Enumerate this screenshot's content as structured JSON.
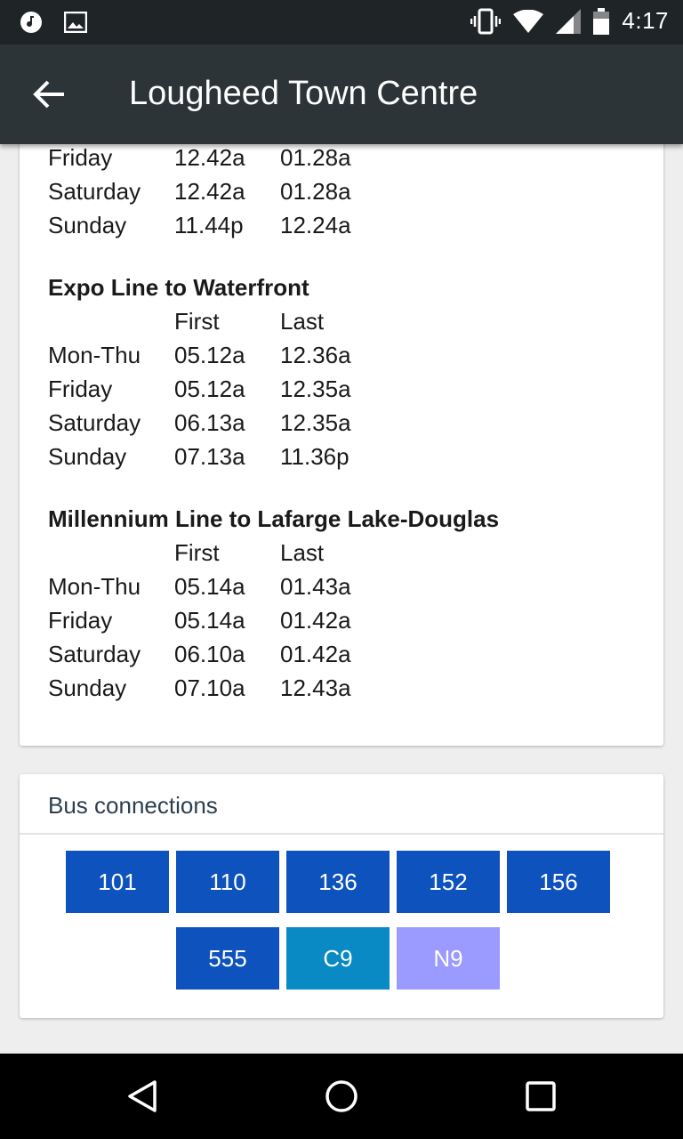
{
  "status_bar": {
    "time": "4:17",
    "icons_left": [
      "music-icon",
      "image-icon"
    ],
    "icons_right": [
      "vibrate-icon",
      "wifi-icon",
      "signal-icon",
      "battery-icon"
    ]
  },
  "app_bar": {
    "title": "Lougheed Town Centre",
    "back_icon": "arrow-back-icon"
  },
  "schedule": {
    "partial_rows": [
      {
        "day": "Friday",
        "first": "12.42a",
        "last": "01.28a"
      },
      {
        "day": "Saturday",
        "first": "12.42a",
        "last": "01.28a"
      },
      {
        "day": "Sunday",
        "first": "11.44p",
        "last": "12.24a"
      }
    ],
    "sections": [
      {
        "title": "Expo Line to Waterfront",
        "first_label": "First",
        "last_label": "Last",
        "rows": [
          {
            "day": "Mon-Thu",
            "first": "05.12a",
            "last": "12.36a"
          },
          {
            "day": "Friday",
            "first": "05.12a",
            "last": "12.35a"
          },
          {
            "day": "Saturday",
            "first": "06.13a",
            "last": "12.35a"
          },
          {
            "day": "Sunday",
            "first": "07.13a",
            "last": "11.36p"
          }
        ]
      },
      {
        "title": "Millennium Line to Lafarge Lake-Douglas",
        "first_label": "First",
        "last_label": "Last",
        "rows": [
          {
            "day": "Mon-Thu",
            "first": "05.14a",
            "last": "01.43a"
          },
          {
            "day": "Friday",
            "first": "05.14a",
            "last": "01.42a"
          },
          {
            "day": "Saturday",
            "first": "06.10a",
            "last": "01.42a"
          },
          {
            "day": "Sunday",
            "first": "07.10a",
            "last": "12.43a"
          }
        ]
      }
    ]
  },
  "bus_connections": {
    "title": "Bus connections",
    "routes": [
      {
        "label": "101",
        "color": "#0d52bd"
      },
      {
        "label": "110",
        "color": "#0d52bd"
      },
      {
        "label": "136",
        "color": "#0d52bd"
      },
      {
        "label": "152",
        "color": "#0d52bd"
      },
      {
        "label": "156",
        "color": "#0d52bd"
      },
      {
        "label": "555",
        "color": "#0d52bd"
      },
      {
        "label": "C9",
        "color": "#0a8ac4"
      },
      {
        "label": "N9",
        "color": "#9b9bff"
      }
    ]
  },
  "nav_bar": {
    "icons": [
      "back-triangle-icon",
      "home-circle-icon",
      "recents-square-icon"
    ]
  }
}
